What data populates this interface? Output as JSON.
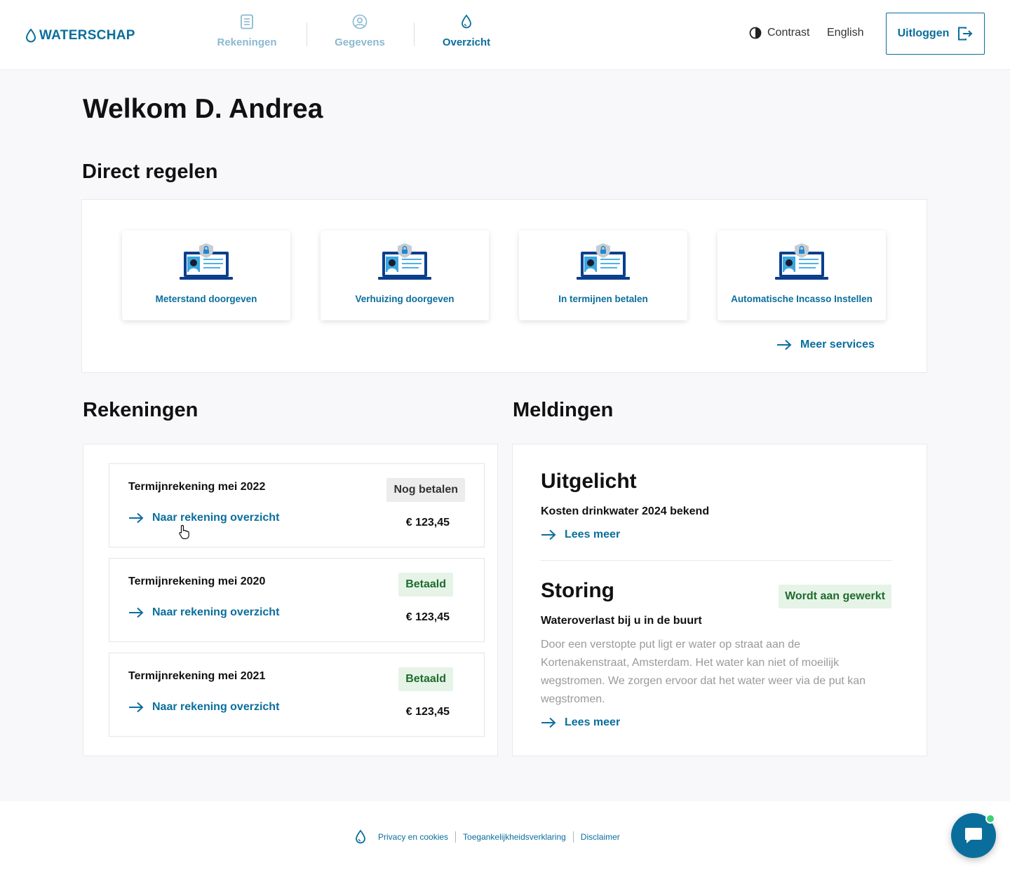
{
  "brand": {
    "name": "WATERSCHAP",
    "accent": "#0a6e9c"
  },
  "nav": [
    {
      "label": "Rekeningen",
      "icon": "document-icon",
      "active": false
    },
    {
      "label": "Gegevens",
      "icon": "user-circle-icon",
      "active": false
    },
    {
      "label": "Overzicht",
      "icon": "water-drop-icon",
      "active": true
    }
  ],
  "header": {
    "contrast_label": "Contrast",
    "language_label": "English",
    "logout_label": "Uitloggen"
  },
  "welcome": "Welkom D. Andrea",
  "direct": {
    "title": "Direct regelen",
    "cards": [
      {
        "label": "Meterstand doorgeven"
      },
      {
        "label": "Verhuizing doorgeven"
      },
      {
        "label": "In termijnen betalen"
      },
      {
        "label": "Automatische Incasso Instellen"
      }
    ],
    "more_label": "Meer services"
  },
  "rekeningen": {
    "title": "Rekeningen",
    "items": [
      {
        "title": "Termijnrekening mei 2022",
        "status": "Nog betalen",
        "link": "Naar rekening overzicht",
        "amount": "€ 123,45"
      },
      {
        "title": "Termijnrekening mei 2020",
        "status": "Betaald",
        "link": "Naar rekening overzicht",
        "amount": "€ 123,45"
      },
      {
        "title": "Termijnrekening mei 2021",
        "status": "Betaald",
        "link": "Naar rekening overzicht",
        "amount": "€ 123,45"
      }
    ]
  },
  "meldingen": {
    "title": "Meldingen",
    "uitgelicht": {
      "heading": "Uitgelicht",
      "subtitle": "Kosten drinkwater 2024 bekend",
      "link": "Lees meer"
    },
    "storing": {
      "heading": "Storing",
      "status": "Wordt aan gewerkt",
      "subtitle": "Wateroverlast bij u in de buurt",
      "body": "Door een verstopte put ligt er water op straat aan de Kortenakenstraat, Amsterdam. Het water kan niet of moeilijk wegstromen. We zorgen ervoor dat het water weer via de put kan wegstromen.",
      "link": "Lees meer"
    }
  },
  "footer": {
    "links": [
      "Privacy en cookies",
      "Toegankelijkheidsverklaring",
      "Disclaimer"
    ]
  }
}
